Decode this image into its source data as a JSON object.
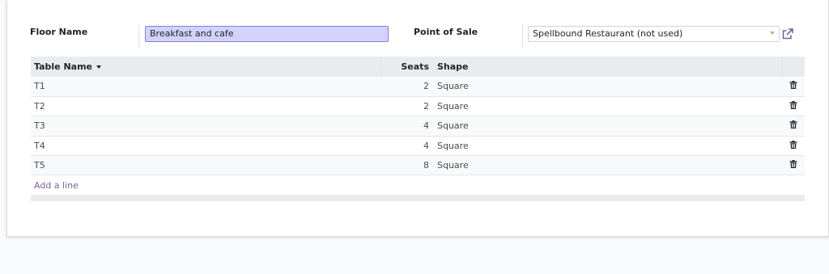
{
  "form": {
    "floor_name_label": "Floor Name",
    "floor_name_value": "Breakfast and cafe",
    "pos_label": "Point of Sale",
    "pos_value": "Spellbound Restaurant (not used)"
  },
  "table": {
    "columns": {
      "name": "Table Name",
      "seats": "Seats",
      "shape": "Shape"
    },
    "sort_indicator_icon": "caret-down-icon",
    "rows": [
      {
        "name": "T1",
        "seats": "2",
        "shape": "Square"
      },
      {
        "name": "T2",
        "seats": "2",
        "shape": "Square"
      },
      {
        "name": "T3",
        "seats": "4",
        "shape": "Square"
      },
      {
        "name": "T4",
        "seats": "4",
        "shape": "Square"
      },
      {
        "name": "T5",
        "seats": "8",
        "shape": "Square"
      }
    ],
    "row_action_icon": "trash-icon",
    "add_line_label": "Add a line"
  },
  "colors": {
    "accent": "#7c5f9e",
    "input_highlight": "#d4d2fb",
    "external_link": "#7c5f9e"
  }
}
